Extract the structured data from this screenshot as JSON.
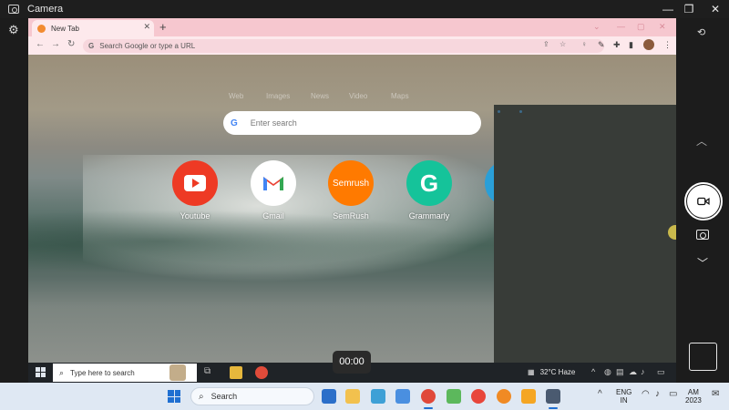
{
  "camera_app": {
    "title": "Camera",
    "window_controls": {
      "minimize": "—",
      "maximize": "❐",
      "close": "✕"
    },
    "timer": "00:00",
    "controls": [
      "settings-icon",
      "camera-switch-icon",
      "chevron-up-icon",
      "video-record-button",
      "photo-mode-icon",
      "chevron-down-icon",
      "last-capture-thumbnail"
    ]
  },
  "browser": {
    "tab": {
      "title": "New Tab",
      "close": "✕"
    },
    "new_tab": "+",
    "omnibox": {
      "placeholder": "Search Google or type a URL"
    },
    "ntp": {
      "search_links": [
        "Web",
        "Images",
        "News",
        "Video",
        "Maps"
      ],
      "search_placeholder": "Enter search",
      "shortcuts": [
        {
          "label": "Youtube",
          "icon": "youtube-icon",
          "color": "#ee3a24"
        },
        {
          "label": "Gmail",
          "icon": "gmail-icon",
          "color": "#ffffff"
        },
        {
          "label": "SemRush",
          "icon": "semrush-icon",
          "color": "#ff7a00",
          "text": "Semrush"
        },
        {
          "label": "Grammarly",
          "icon": "grammarly-icon",
          "color": "#15c39a",
          "text": "G"
        }
      ]
    }
  },
  "inner_taskbar": {
    "search_placeholder": "Type here to search",
    "weather": "32°C Haze"
  },
  "taskbar": {
    "search_placeholder": "Search",
    "language": {
      "line1": "ENG",
      "line2": "IN"
    },
    "clock": {
      "time": "AM",
      "year": "2023"
    }
  },
  "colors": {
    "accent": "#1f6fd1",
    "tab_strip": "#f6c7cf",
    "toolbar": "#fde9ec"
  }
}
